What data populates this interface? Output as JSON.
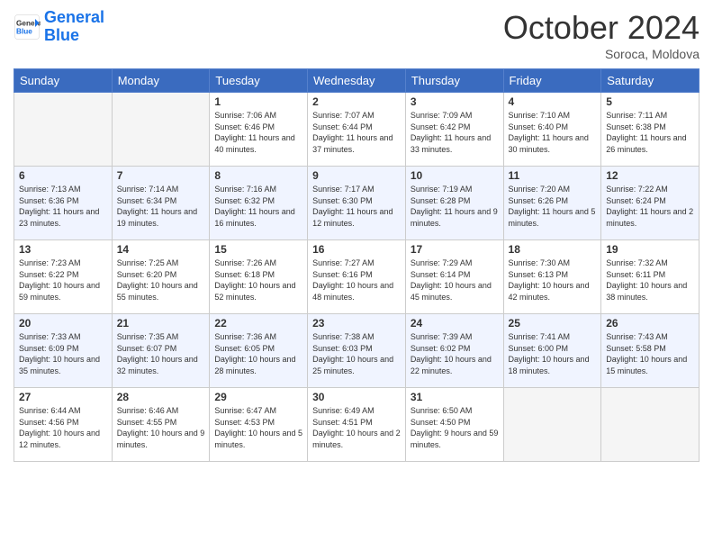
{
  "header": {
    "logo_line1": "General",
    "logo_line2": "Blue",
    "month": "October 2024",
    "location": "Soroca, Moldova"
  },
  "days_of_week": [
    "Sunday",
    "Monday",
    "Tuesday",
    "Wednesday",
    "Thursday",
    "Friday",
    "Saturday"
  ],
  "weeks": [
    [
      {
        "day": "",
        "info": ""
      },
      {
        "day": "",
        "info": ""
      },
      {
        "day": "1",
        "info": "Sunrise: 7:06 AM\nSunset: 6:46 PM\nDaylight: 11 hours and 40 minutes."
      },
      {
        "day": "2",
        "info": "Sunrise: 7:07 AM\nSunset: 6:44 PM\nDaylight: 11 hours and 37 minutes."
      },
      {
        "day": "3",
        "info": "Sunrise: 7:09 AM\nSunset: 6:42 PM\nDaylight: 11 hours and 33 minutes."
      },
      {
        "day": "4",
        "info": "Sunrise: 7:10 AM\nSunset: 6:40 PM\nDaylight: 11 hours and 30 minutes."
      },
      {
        "day": "5",
        "info": "Sunrise: 7:11 AM\nSunset: 6:38 PM\nDaylight: 11 hours and 26 minutes."
      }
    ],
    [
      {
        "day": "6",
        "info": "Sunrise: 7:13 AM\nSunset: 6:36 PM\nDaylight: 11 hours and 23 minutes."
      },
      {
        "day": "7",
        "info": "Sunrise: 7:14 AM\nSunset: 6:34 PM\nDaylight: 11 hours and 19 minutes."
      },
      {
        "day": "8",
        "info": "Sunrise: 7:16 AM\nSunset: 6:32 PM\nDaylight: 11 hours and 16 minutes."
      },
      {
        "day": "9",
        "info": "Sunrise: 7:17 AM\nSunset: 6:30 PM\nDaylight: 11 hours and 12 minutes."
      },
      {
        "day": "10",
        "info": "Sunrise: 7:19 AM\nSunset: 6:28 PM\nDaylight: 11 hours and 9 minutes."
      },
      {
        "day": "11",
        "info": "Sunrise: 7:20 AM\nSunset: 6:26 PM\nDaylight: 11 hours and 5 minutes."
      },
      {
        "day": "12",
        "info": "Sunrise: 7:22 AM\nSunset: 6:24 PM\nDaylight: 11 hours and 2 minutes."
      }
    ],
    [
      {
        "day": "13",
        "info": "Sunrise: 7:23 AM\nSunset: 6:22 PM\nDaylight: 10 hours and 59 minutes."
      },
      {
        "day": "14",
        "info": "Sunrise: 7:25 AM\nSunset: 6:20 PM\nDaylight: 10 hours and 55 minutes."
      },
      {
        "day": "15",
        "info": "Sunrise: 7:26 AM\nSunset: 6:18 PM\nDaylight: 10 hours and 52 minutes."
      },
      {
        "day": "16",
        "info": "Sunrise: 7:27 AM\nSunset: 6:16 PM\nDaylight: 10 hours and 48 minutes."
      },
      {
        "day": "17",
        "info": "Sunrise: 7:29 AM\nSunset: 6:14 PM\nDaylight: 10 hours and 45 minutes."
      },
      {
        "day": "18",
        "info": "Sunrise: 7:30 AM\nSunset: 6:13 PM\nDaylight: 10 hours and 42 minutes."
      },
      {
        "day": "19",
        "info": "Sunrise: 7:32 AM\nSunset: 6:11 PM\nDaylight: 10 hours and 38 minutes."
      }
    ],
    [
      {
        "day": "20",
        "info": "Sunrise: 7:33 AM\nSunset: 6:09 PM\nDaylight: 10 hours and 35 minutes."
      },
      {
        "day": "21",
        "info": "Sunrise: 7:35 AM\nSunset: 6:07 PM\nDaylight: 10 hours and 32 minutes."
      },
      {
        "day": "22",
        "info": "Sunrise: 7:36 AM\nSunset: 6:05 PM\nDaylight: 10 hours and 28 minutes."
      },
      {
        "day": "23",
        "info": "Sunrise: 7:38 AM\nSunset: 6:03 PM\nDaylight: 10 hours and 25 minutes."
      },
      {
        "day": "24",
        "info": "Sunrise: 7:39 AM\nSunset: 6:02 PM\nDaylight: 10 hours and 22 minutes."
      },
      {
        "day": "25",
        "info": "Sunrise: 7:41 AM\nSunset: 6:00 PM\nDaylight: 10 hours and 18 minutes."
      },
      {
        "day": "26",
        "info": "Sunrise: 7:43 AM\nSunset: 5:58 PM\nDaylight: 10 hours and 15 minutes."
      }
    ],
    [
      {
        "day": "27",
        "info": "Sunrise: 6:44 AM\nSunset: 4:56 PM\nDaylight: 10 hours and 12 minutes."
      },
      {
        "day": "28",
        "info": "Sunrise: 6:46 AM\nSunset: 4:55 PM\nDaylight: 10 hours and 9 minutes."
      },
      {
        "day": "29",
        "info": "Sunrise: 6:47 AM\nSunset: 4:53 PM\nDaylight: 10 hours and 5 minutes."
      },
      {
        "day": "30",
        "info": "Sunrise: 6:49 AM\nSunset: 4:51 PM\nDaylight: 10 hours and 2 minutes."
      },
      {
        "day": "31",
        "info": "Sunrise: 6:50 AM\nSunset: 4:50 PM\nDaylight: 9 hours and 59 minutes."
      },
      {
        "day": "",
        "info": ""
      },
      {
        "day": "",
        "info": ""
      }
    ]
  ]
}
